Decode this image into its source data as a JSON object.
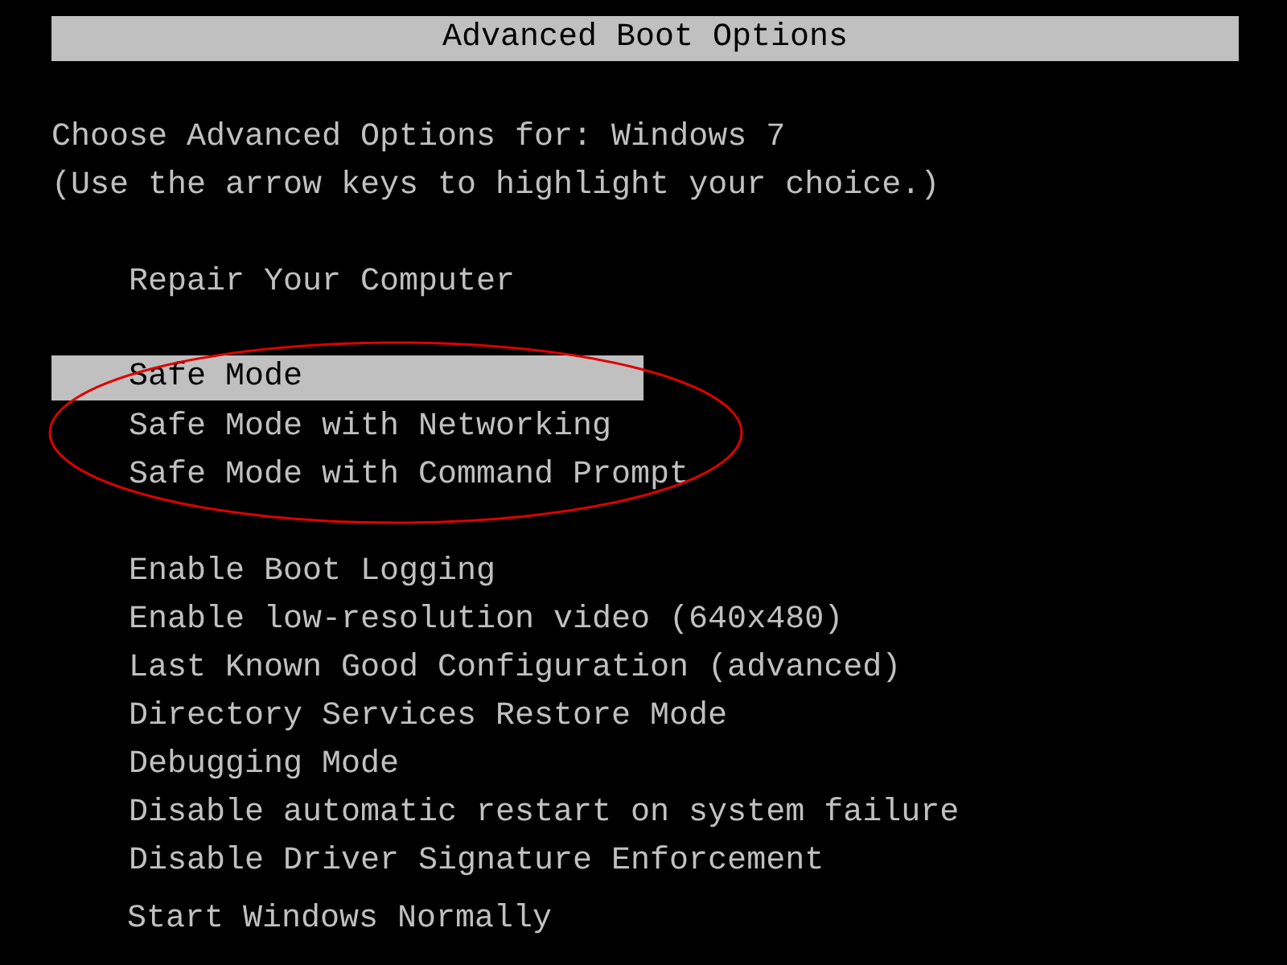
{
  "title_bar": {
    "title": "Advanced Boot Options"
  },
  "prompt": {
    "lines": [
      "Choose Advanced Options for: Windows 7",
      "(Use the arrow keys to highlight your choice.)"
    ]
  },
  "option_groups": [
    {
      "items": [
        {
          "label": "Repair Your Computer",
          "selected": false
        }
      ]
    },
    {
      "items": [
        {
          "label": "Safe Mode",
          "selected": true
        },
        {
          "label": "Safe Mode with Networking",
          "selected": false
        },
        {
          "label": "Safe Mode with Command Prompt",
          "selected": false
        }
      ]
    },
    {
      "items": [
        {
          "label": "Enable Boot Logging",
          "selected": false
        },
        {
          "label": "Enable low-resolution video (640x480)",
          "selected": false
        },
        {
          "label": "Last Known Good Configuration (advanced)",
          "selected": false
        },
        {
          "label": "Directory Services Restore Mode",
          "selected": false
        },
        {
          "label": "Debugging Mode",
          "selected": false
        },
        {
          "label": "Disable automatic restart on system failure",
          "selected": false
        },
        {
          "label": "Disable Driver Signature Enforcement",
          "selected": false
        }
      ]
    }
  ],
  "footer_option": {
    "label": "Start Windows Normally",
    "selected": false
  }
}
